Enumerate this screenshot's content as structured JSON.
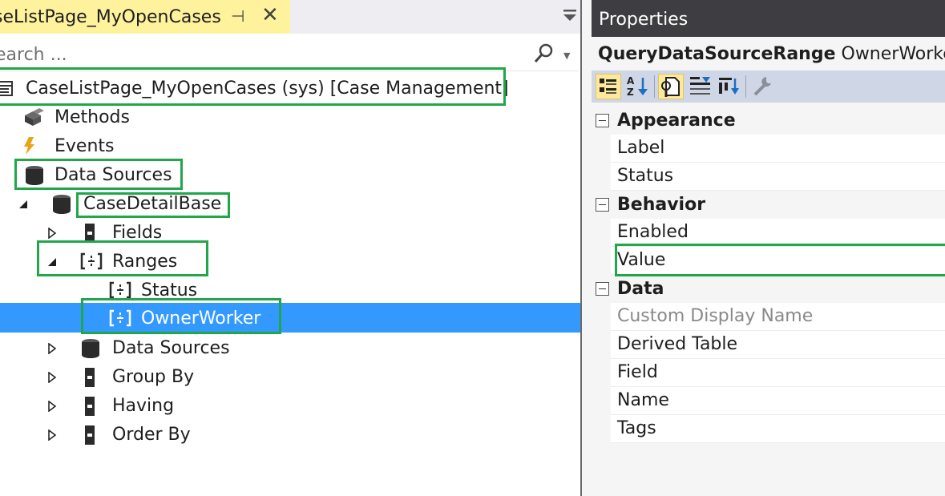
{
  "document_tab": {
    "label": "seListPage_MyOpenCases"
  },
  "search": {
    "placeholder": "earch ..."
  },
  "tree": {
    "root": "CaseListPage_MyOpenCases (sys) [Case Management]",
    "methods": "Methods",
    "events": "Events",
    "data_sources": "Data Sources",
    "case_detail_base": "CaseDetailBase",
    "fields": "Fields",
    "ranges": "Ranges",
    "range_status": "Status",
    "range_owner_worker": "OwnerWorker",
    "nested_data_sources": "Data Sources",
    "group_by": "Group By",
    "having": "Having",
    "order_by": "Order By"
  },
  "properties": {
    "title": "Properties",
    "object_type": "QueryDataSourceRange",
    "object_name": "OwnerWorker",
    "categories": {
      "appearance": "Appearance",
      "behavior": "Behavior",
      "data": "Data"
    },
    "appearance_props": [
      "Label",
      "Status"
    ],
    "behavior_props": [
      "Enabled",
      "Value"
    ],
    "data_props": [
      "Custom Display Name",
      "Derived Table",
      "Field",
      "Name",
      "Tags"
    ]
  },
  "colors": {
    "highlight_box": "#22a64a",
    "selection": "#3399ff",
    "tab_active": "#fff29d",
    "props_header": "#3e3e42"
  }
}
